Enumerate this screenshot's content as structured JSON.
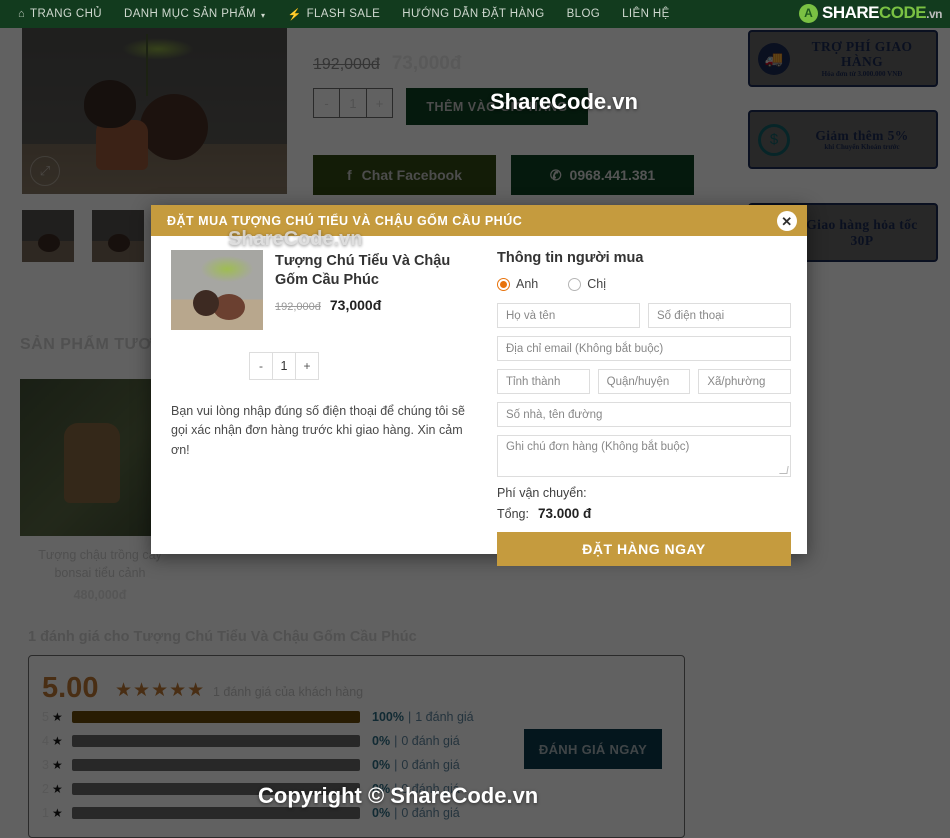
{
  "nav": {
    "items": [
      {
        "label": "TRANG CHỦ",
        "icon": "home-icon",
        "caret": false
      },
      {
        "label": "DANH MỤC SẢN PHẨM",
        "icon": "",
        "caret": true
      },
      {
        "label": "FLASH SALE",
        "icon": "flash-icon",
        "caret": false
      },
      {
        "label": "HƯỚNG DẪN ĐẶT HÀNG",
        "icon": "",
        "caret": false
      },
      {
        "label": "BLOG",
        "icon": "",
        "caret": false
      },
      {
        "label": "LIÊN HỆ",
        "icon": "",
        "caret": false
      }
    ],
    "brand": {
      "mark": "A",
      "part1": "SHARE",
      "part2": "CODE",
      "part3": ".vn"
    }
  },
  "product": {
    "price_old": "192,000đ",
    "price_new": "73,000đ",
    "qty_minus": "-",
    "qty_value": "1",
    "qty_plus": "+",
    "add_to_cart": "THÊM VÀO GIỎ HÀNG",
    "chat_facebook": "Chat Facebook",
    "facebook_icon": "facebook-icon",
    "phone": "0968.441.381",
    "phone_icon": "phone-icon",
    "zoom_icon": "expand-icon"
  },
  "banners": [
    {
      "title": "TRỢ PHÍ GIAO HÀNG",
      "sub": "Hóa đơn từ 3.000.000 VNĐ",
      "icon": "truck-icon"
    },
    {
      "title": "Giảm thêm 5%",
      "sub": "khi Chuyển Khoản trước",
      "icon": "money-hand-icon"
    },
    {
      "title": "Giao hàng hỏa tốc 30P",
      "sub": "",
      "icon": "scooter-icon"
    }
  ],
  "related": {
    "section_title": "SẢN PHẨM TƯƠNG TỰ",
    "items": [
      {
        "name": "Tượng chậu trồng cây bonsai tiểu cảnh",
        "price": "480,000đ"
      }
    ]
  },
  "reviews": {
    "heading": "1 đánh giá cho Tượng Chú Tiểu Và Chậu Gốm Cầu Phúc",
    "score": "5.00",
    "stars": "★★★★★",
    "count_label": "1 đánh giá của khách hàng",
    "rate_button": "ĐÁNH GIÁ NGAY",
    "bars": [
      {
        "star": "5",
        "pct": "100%",
        "pct_value": 100,
        "count": "1 đánh giá"
      },
      {
        "star": "4",
        "pct": "0%",
        "pct_value": 0,
        "count": "0 đánh giá"
      },
      {
        "star": "3",
        "pct": "0%",
        "pct_value": 0,
        "count": "0 đánh giá"
      },
      {
        "star": "2",
        "pct": "0%",
        "pct_value": 0,
        "count": "0 đánh giá"
      },
      {
        "star": "1",
        "pct": "0%",
        "pct_value": 0,
        "count": "0 đánh giá"
      }
    ],
    "separator": "|"
  },
  "modal": {
    "title": "ĐẶT MUA TƯỢNG CHÚ TIỂU VÀ CHẬU GỐM CẦU PHÚC",
    "close_icon": "close-icon",
    "product": {
      "name": "Tượng Chú Tiểu Và Chậu Gốm Cầu Phúc",
      "price_old": "192,000đ",
      "price_new": "73,000đ",
      "qty_minus": "-",
      "qty_value": "1",
      "qty_plus": "+"
    },
    "note": "Bạn vui lòng nhập đúng số điện thoại để chúng tôi sẽ gọi xác nhận đơn hàng trước khi giao hàng. Xin cảm ơn!",
    "form": {
      "title": "Thông tin người mua",
      "gender_male": "Anh",
      "gender_female": "Chị",
      "gender_selected": "Anh",
      "name_placeholder": "Họ và tên",
      "phone_placeholder": "Số điện thoại",
      "email_placeholder": "Địa chỉ email (Không bắt buộc)",
      "province_placeholder": "Tỉnh thành",
      "district_placeholder": "Quận/huyện",
      "ward_placeholder": "Xã/phường",
      "address_placeholder": "Số nhà, tên đường",
      "note_placeholder": "Ghi chú đơn hàng (Không bắt buộc)",
      "shipping_label": "Phí vận chuyển:",
      "shipping_value": "",
      "total_label": "Tổng:",
      "total_value": "73.000 đ",
      "submit": "ĐẶT HÀNG NGAY"
    }
  },
  "watermarks": {
    "top": "ShareCode.vn",
    "modal": "ShareCode.vn",
    "bottom": "Copyright © ShareCode.vn"
  },
  "colors": {
    "nav_green": "#123b1e",
    "gold": "#c59b3e",
    "dark_green": "#0e4322",
    "radio_orange": "#e8730c",
    "review_teal": "#0c3a4c",
    "star_orange": "#c07a35"
  }
}
